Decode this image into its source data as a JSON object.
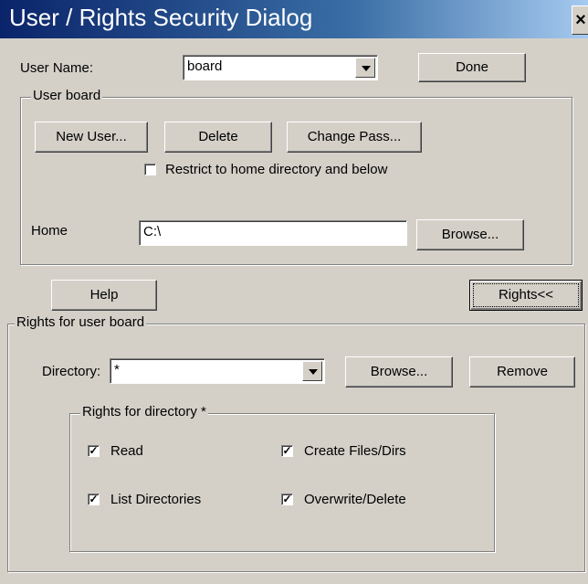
{
  "window": {
    "title": "User / Rights Security Dialog",
    "close_label": "×"
  },
  "user": {
    "name_label": "User Name:",
    "name_value": "board",
    "done_label": "Done"
  },
  "user_group": {
    "legend": "User board",
    "new_user_label": "New User...",
    "delete_label": "Delete",
    "change_pass_label": "Change Pass...",
    "restrict_label": "Restrict to home directory and below",
    "restrict_checked": false,
    "home_label": "Home",
    "home_value": "C:\\",
    "browse_label": "Browse..."
  },
  "help_label": "Help",
  "rights_toggle_label": "Rights<<",
  "rights_group": {
    "legend": "Rights for user board",
    "directory_label": "Directory:",
    "directory_value": "*",
    "browse_label": "Browse...",
    "remove_label": "Remove",
    "dir_rights": {
      "legend": "Rights for directory *",
      "read_label": "Read",
      "create_label": "Create Files/Dirs",
      "list_label": "List Directories",
      "overwrite_label": "Overwrite/Delete",
      "check_mark": "✓"
    }
  }
}
